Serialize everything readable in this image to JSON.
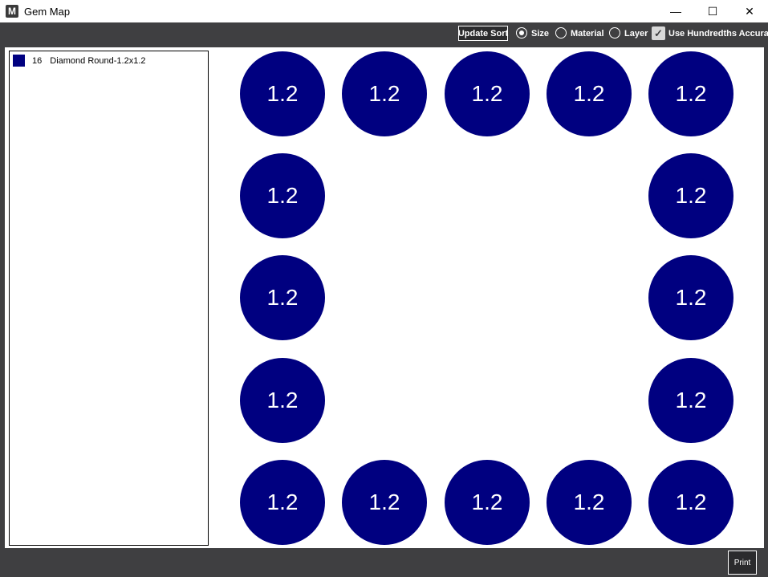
{
  "window": {
    "title": "Gem Map",
    "icon_letter": "M",
    "controls": {
      "minimize": "—",
      "maximize": "☐",
      "close": "✕"
    }
  },
  "toolbar": {
    "update_sort_label": "Update Sort",
    "sort_options": [
      {
        "label": "Size",
        "selected": true
      },
      {
        "label": "Material",
        "selected": false
      },
      {
        "label": "Layer",
        "selected": false
      }
    ],
    "hundredths": {
      "label": "Use Hundredths Accuracy",
      "checked": true
    }
  },
  "legend": {
    "items": [
      {
        "count": "16",
        "label": "Diamond Round-1.2x1.2",
        "color": "#000080"
      }
    ]
  },
  "gems": {
    "color": "#000080",
    "labels": [
      "1.2",
      "1.2",
      "1.2",
      "1.2",
      "1.2",
      "1.2",
      "1.2",
      "1.2",
      "1.2",
      "1.2",
      "1.2",
      "1.2",
      "1.2",
      "1.2",
      "1.2",
      "1.2"
    ]
  },
  "footer": {
    "print_label": "Print"
  }
}
